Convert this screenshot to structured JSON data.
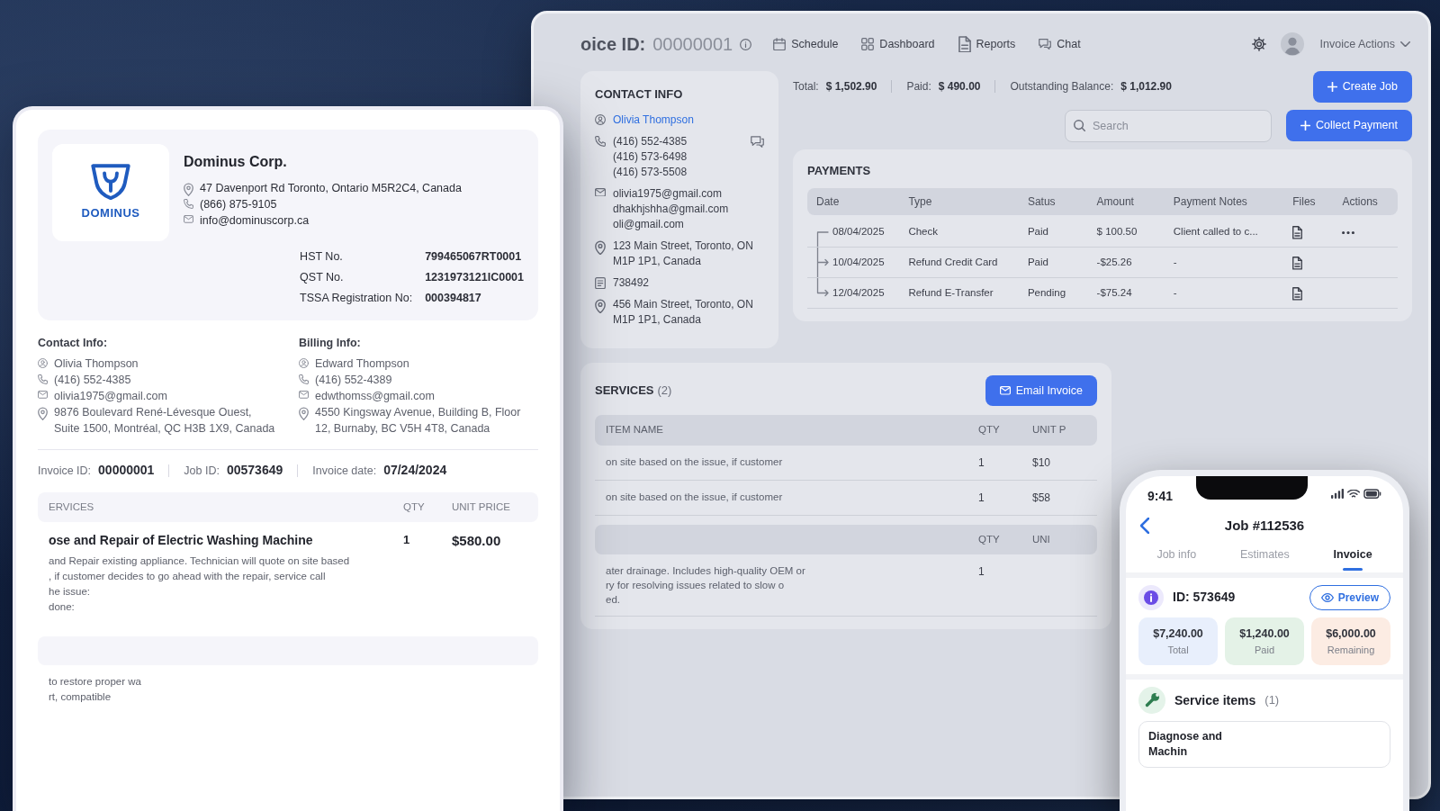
{
  "app_window": {
    "title": {
      "label": "oice ID:",
      "value": "00000001"
    },
    "nav": [
      "Schedule",
      "Dashboard",
      "Reports",
      "Chat"
    ],
    "invoice_actions": "Invoice Actions",
    "contact_info": {
      "heading": "CONTACT INFO",
      "entries": [
        {
          "kind": "name",
          "lines": [
            "Olivia Thompson"
          ]
        },
        {
          "kind": "phone",
          "lines": [
            "(416) 552-4385",
            "(416) 573-6498",
            "(416) 573-5508"
          ]
        },
        {
          "kind": "email",
          "lines": [
            "olivia1975@gmail.com",
            "dhakhjshha@gmail.com",
            "oli@gmail.com"
          ]
        },
        {
          "kind": "address",
          "lines": [
            "123 Main Street, Toronto, ON M1P 1P1, Canada"
          ]
        },
        {
          "kind": "id",
          "lines": [
            "738492"
          ]
        },
        {
          "kind": "address",
          "lines": [
            "456 Main Street, Toronto, ON M1P 1P1, Canada"
          ]
        }
      ]
    },
    "totals": [
      {
        "label": "Total:",
        "value": "$ 1,502.90"
      },
      {
        "label": "Paid:",
        "value": "$ 490.00"
      },
      {
        "label": "Outstanding Balance:",
        "value": "$ 1,012.90"
      }
    ],
    "create_job_button": "Create Job",
    "search": {
      "placeholder": "Search"
    },
    "collect_payment_button": "Collect Payment",
    "payments": {
      "heading": "PAYMENTS",
      "columns": [
        "Date",
        "Type",
        "Satus",
        "Amount",
        "Payment Notes",
        "Files",
        "Actions"
      ],
      "rows": [
        {
          "date": "08/04/2025",
          "type": "Check",
          "status": "Paid",
          "amount": "$ 100.50",
          "notes": "Client called to c...",
          "has_actions": true,
          "children": [
            {
              "date": "10/04/2025",
              "type": "Refund Credit Card",
              "status": "Paid",
              "amount": "-$25.26",
              "notes": "-",
              "has_actions": false
            },
            {
              "date": "12/04/2025",
              "type": "Refund E-Transfer",
              "status": "Pending",
              "amount": "-$75.24",
              "notes": "-",
              "has_actions": false
            }
          ]
        }
      ]
    },
    "services": {
      "heading": "SERVICES",
      "count": "(2)",
      "email_button": "Email Invoice",
      "tables": [
        {
          "item_column": "ITEM NAME",
          "qty_column": "QTY",
          "price_column": "UNIT P",
          "rows": [
            {
              "lines": [
                "on site based on the issue, if customer"
              ],
              "qty": "1",
              "unit_price": "$10"
            },
            {
              "lines": [
                "on site based on the issue, if customer"
              ],
              "qty": "1",
              "unit_price": "$58"
            }
          ]
        },
        {
          "qty_column": "QTY",
          "price_column": "UNI",
          "rows": [
            {
              "lines": [
                "ater drainage. Includes high-quality OEM or",
                "ry for resolving issues related to slow o",
                "ed."
              ],
              "qty": "1"
            }
          ]
        }
      ]
    }
  },
  "invoice": {
    "logo_text": "DOMINUS",
    "company": {
      "name": "Dominus Corp.",
      "entries": [
        {
          "kind": "address",
          "lines": [
            "47 Davenport Rd Toronto, Ontario M5R2C4, Canada"
          ]
        },
        {
          "kind": "phone",
          "lines": [
            "(866) 875-9105"
          ]
        },
        {
          "kind": "email",
          "lines": [
            "info@dominuscorp.ca"
          ]
        }
      ]
    },
    "tax_numbers": [
      {
        "label": "HST No.",
        "value": "799465067RT0001"
      },
      {
        "label": "QST No.",
        "value": "1231973121IC0001"
      },
      {
        "label": "TSSA Registration No:",
        "value": "000394817"
      }
    ],
    "contact": {
      "heading": "Contact Info:",
      "entries": [
        {
          "kind": "name",
          "lines": [
            "Olivia Thompson"
          ]
        },
        {
          "kind": "phone",
          "lines": [
            "(416) 552-4385"
          ]
        },
        {
          "kind": "email",
          "lines": [
            "olivia1975@gmail.com"
          ]
        },
        {
          "kind": "address",
          "lines": [
            "9876 Boulevard René-Lévesque Ouest, Suite 1500, Montréal, QC H3B 1X9, Canada"
          ]
        }
      ]
    },
    "billing": {
      "heading": "Billing Info:",
      "entries": [
        {
          "kind": "name",
          "lines": [
            "Edward Thompson"
          ]
        },
        {
          "kind": "phone",
          "lines": [
            "(416) 552-4389"
          ]
        },
        {
          "kind": "email",
          "lines": [
            "edwthomss@gmail.com"
          ]
        },
        {
          "kind": "address",
          "lines": [
            "4550 Kingsway Avenue, Building B, Floor 12, Burnaby, BC V5H 4T8, Canada"
          ]
        }
      ]
    },
    "meta": [
      {
        "label": "Invoice ID:",
        "value": "00000001"
      },
      {
        "label": "Job ID:",
        "value": "00573649"
      },
      {
        "label": "Invoice date:",
        "value": "07/24/2024"
      }
    ],
    "services": {
      "tables": [
        {
          "item_column": "ERVICES",
          "qty_column": "QTY",
          "price_column": "UNIT PRICE",
          "rows": [
            {
              "title": "ose and Repair of Electric Washing Machine",
              "lines": [
                "and Repair existing appliance. Technician will quote on site based",
                ", if customer decides to go ahead with the repair, service call",
                "he issue:",
                "done:"
              ],
              "qty": "1",
              "unit_price": "$580.00"
            }
          ]
        },
        {
          "rows": [
            {
              "lines": [
                "to restore proper wa",
                "rt, compatible"
              ]
            }
          ]
        }
      ]
    }
  },
  "phone": {
    "time": "9:41",
    "title": "Job #112536",
    "tabs": [
      {
        "label": "Job info",
        "selected": false
      },
      {
        "label": "Estimates",
        "selected": false
      },
      {
        "label": "Invoice",
        "selected": true
      }
    ],
    "job_id": "ID: 573649",
    "preview_button": "Preview",
    "stats": [
      {
        "value": "$7,240.00",
        "label": "Total",
        "color": "#e8effc"
      },
      {
        "value": "$1,240.00",
        "label": "Paid",
        "color": "#e4f2e7"
      },
      {
        "value": "$6,000.00",
        "label": "Remaining",
        "color": "#fcece3"
      }
    ],
    "service_items": {
      "heading": "Service items",
      "count": "(1)",
      "lines": [
        "Diagnose and",
        "Machin"
      ]
    }
  }
}
